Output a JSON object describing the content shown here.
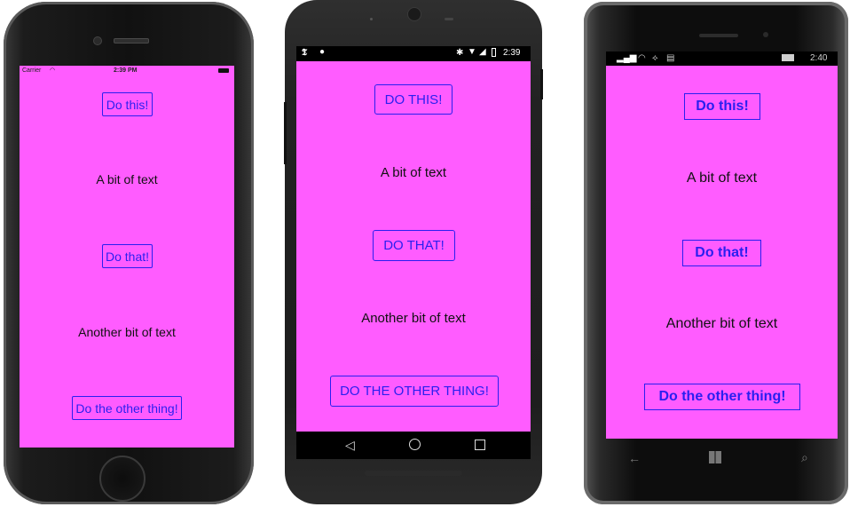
{
  "iphone": {
    "status": {
      "carrier": "Carrier",
      "time": "2:39 PM"
    },
    "button1": "Do this!",
    "text1": "A bit of text",
    "button2": "Do that!",
    "text2": "Another bit of text",
    "button3": "Do the other thing!"
  },
  "android": {
    "status": {
      "time": "2:39"
    },
    "button1": "DO THIS!",
    "text1": "A bit of text",
    "button2": "DO THAT!",
    "text2": "Another bit of text",
    "button3": "DO THE OTHER THING!"
  },
  "windows": {
    "status": {
      "time": "2:40"
    },
    "button1": "Do this!",
    "text1": "A bit of text",
    "button2": "Do that!",
    "text2": "Another bit of text",
    "button3": "Do the other thing!"
  },
  "colors": {
    "background": "#ff5cff",
    "accent": "#2a1ff0",
    "text": "#111111"
  }
}
